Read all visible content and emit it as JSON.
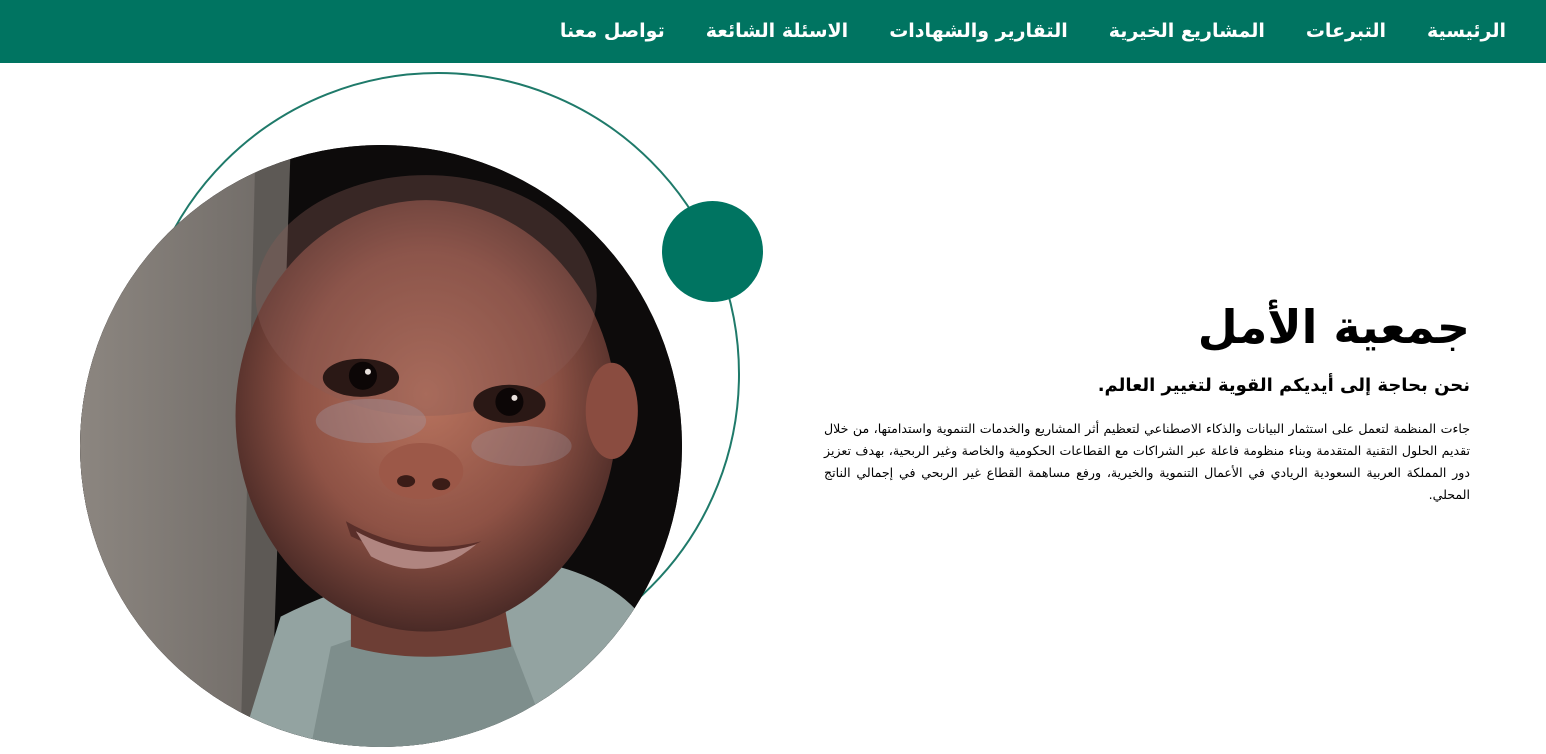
{
  "nav": {
    "items": [
      {
        "label": "الرئيسية"
      },
      {
        "label": "التبرعات"
      },
      {
        "label": "المشاريع الخيرية"
      },
      {
        "label": "التقارير والشهادات"
      },
      {
        "label": "الاسئلة الشائعة"
      },
      {
        "label": "تواصل معنا"
      }
    ]
  },
  "hero": {
    "title": "جمعية الأمل",
    "subtitle": "نحن بحاجة إلى أيديكم القوية لتغيير العالم.",
    "body": "جاءت المنظمة لتعمل على استثمار البيانات والذكاء الاصطناعي لتعظيم أثر المشاريع والخدمات التنموية واستدامتها، من خلال تقديم الحلول التقنية المتقدمة وبناء منظومة فاعلة عبر الشراكات مع القطاعات الحكومية والخاصة وغير الربحية، بهدف تعزيز دور المملكة العربية السعودية الريادي في الأعمال التنموية والخيرية، ورفع مساهمة القطاع غير الربحي في إجمالي الناتج المحلي."
  },
  "colors": {
    "brand": "#007461",
    "ring": "#1f7a6a",
    "text": "#000000",
    "background": "#ffffff"
  },
  "icons": {
    "photo": "child-portrait-photo",
    "decor_dot": "accent-circle",
    "decor_ring": "outline-circle"
  }
}
